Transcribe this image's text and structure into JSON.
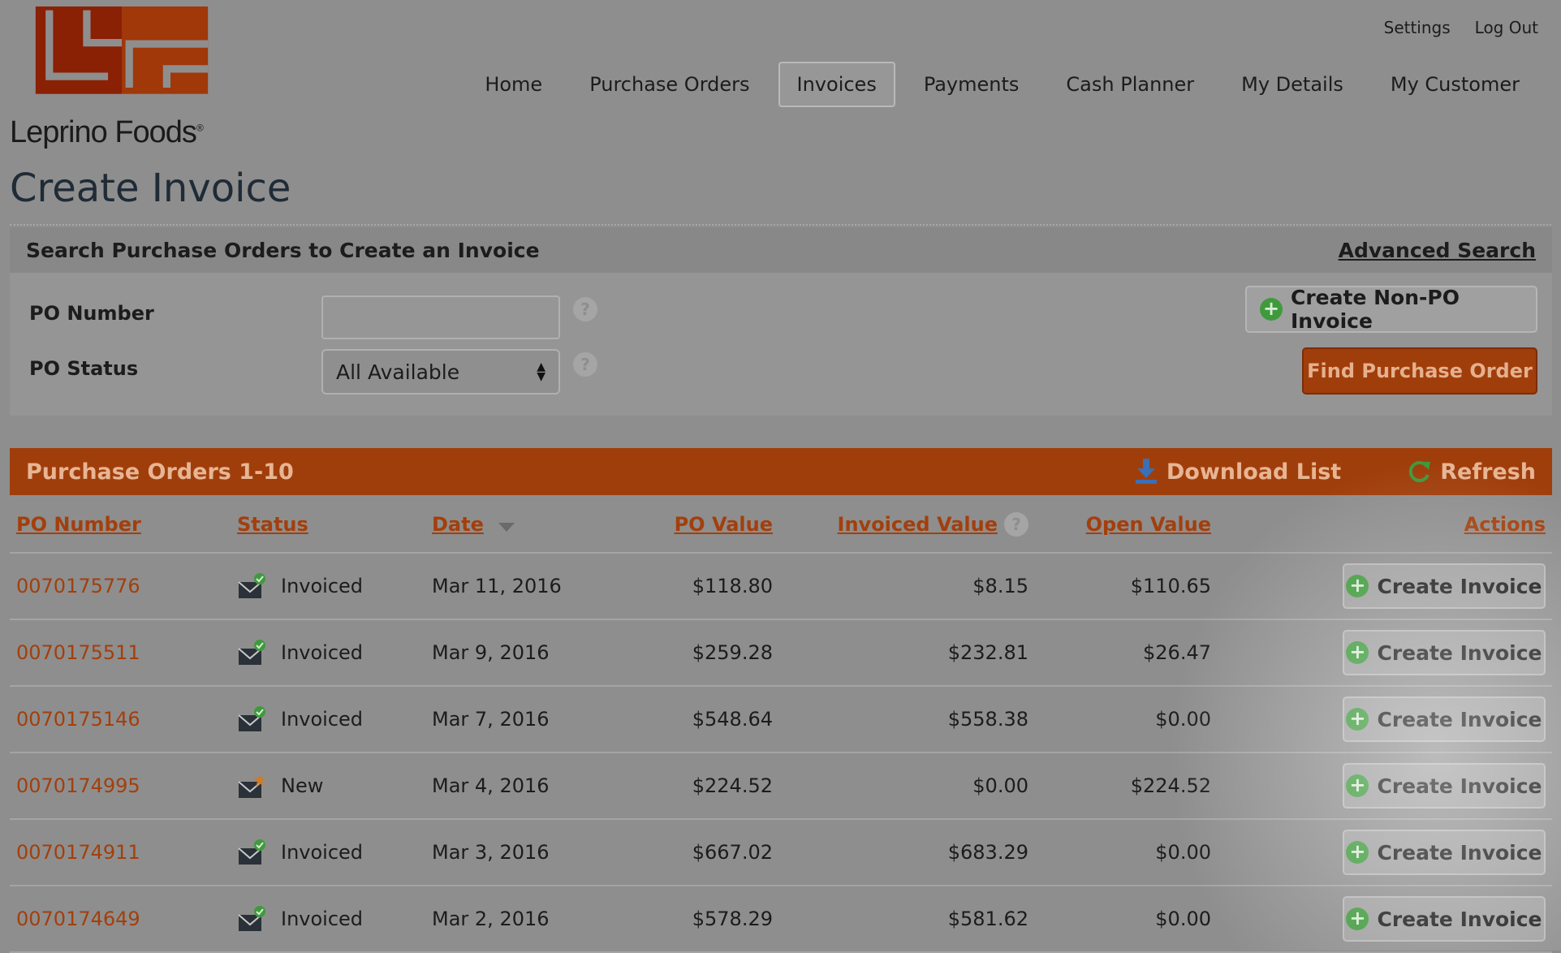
{
  "brand": {
    "name": "Leprino Foods",
    "registered": "®"
  },
  "utility_nav": {
    "settings": "Settings",
    "logout": "Log Out"
  },
  "main_nav": {
    "items": [
      {
        "label": "Home"
      },
      {
        "label": "Purchase Orders"
      },
      {
        "label": "Invoices",
        "active": true
      },
      {
        "label": "Payments"
      },
      {
        "label": "Cash Planner"
      },
      {
        "label": "My Details"
      },
      {
        "label": "My Customer"
      }
    ]
  },
  "page": {
    "title": "Create Invoice"
  },
  "search": {
    "heading": "Search Purchase Orders to Create an Invoice",
    "advanced_link": "Advanced Search",
    "po_number_label": "PO Number",
    "po_number_value": "",
    "po_status_label": "PO Status",
    "po_status_selected": "All Available",
    "help_glyph": "?",
    "create_non_po_label": "Create Non-PO Invoice",
    "find_po_label": "Find Purchase Order"
  },
  "orders": {
    "heading": "Purchase Orders 1-10",
    "download_label": "Download List",
    "refresh_label": "Refresh",
    "columns": {
      "po_number": "PO Number",
      "status": "Status",
      "date": "Date",
      "po_value": "PO Value",
      "invoiced_value": "Invoiced Value",
      "open_value": "Open Value",
      "actions": "Actions"
    },
    "create_invoice_label": "Create Invoice",
    "rows": [
      {
        "po": "0070175776",
        "status": "Invoiced",
        "date": "Mar 11, 2016",
        "po_value": "$118.80",
        "invoiced": "$8.15",
        "open": "$110.65"
      },
      {
        "po": "0070175511",
        "status": "Invoiced",
        "date": "Mar 9, 2016",
        "po_value": "$259.28",
        "invoiced": "$232.81",
        "open": "$26.47"
      },
      {
        "po": "0070175146",
        "status": "Invoiced",
        "date": "Mar 7, 2016",
        "po_value": "$548.64",
        "invoiced": "$558.38",
        "open": "$0.00"
      },
      {
        "po": "0070174995",
        "status": "New",
        "date": "Mar 4, 2016",
        "po_value": "$224.52",
        "invoiced": "$0.00",
        "open": "$224.52"
      },
      {
        "po": "0070174911",
        "status": "Invoiced",
        "date": "Mar 3, 2016",
        "po_value": "$667.02",
        "invoiced": "$683.29",
        "open": "$0.00"
      },
      {
        "po": "0070174649",
        "status": "Invoiced",
        "date": "Mar 2, 2016",
        "po_value": "$578.29",
        "invoiced": "$581.62",
        "open": "$0.00"
      }
    ]
  },
  "colors": {
    "brand_orange": "#a03e0b",
    "logo_red": "#8a2004",
    "accent_green": "#3f9a3d",
    "overlay_grey": "#8e8e8e"
  }
}
